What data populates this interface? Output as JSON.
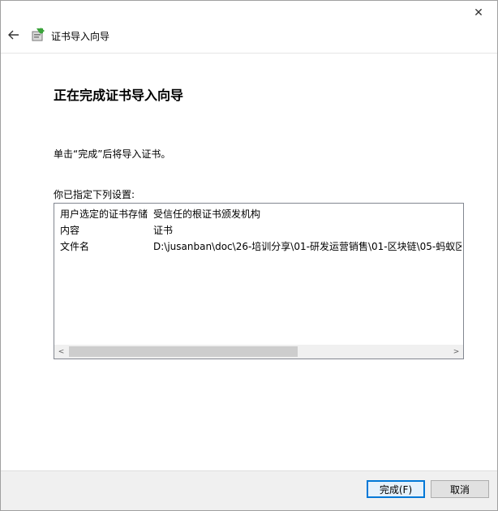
{
  "window": {
    "close_symbol": "✕",
    "title": "证书导入向导",
    "icon": "certificate-wizard-icon",
    "back_icon": "back-arrow-icon"
  },
  "page": {
    "title": "正在完成证书导入向导",
    "instruction": "单击“完成”后将导入证书。",
    "settings_label": "你已指定下列设置:"
  },
  "settings": {
    "rows": [
      {
        "key": "用户选定的证书存储",
        "value": "受信任的根证书颁发机构"
      },
      {
        "key": "内容",
        "value": "证书"
      },
      {
        "key": "文件名",
        "value": "D:\\jusanban\\doc\\26-培训分享\\01-研发运营销售\\01-区块链\\05-蚂蚁区"
      }
    ],
    "scroll_left": "<",
    "scroll_right": ">"
  },
  "buttons": {
    "finish": "完成(F)",
    "cancel": "取消"
  },
  "colors": {
    "accent": "#0078d7",
    "footer_bg": "#f0f0f0"
  }
}
